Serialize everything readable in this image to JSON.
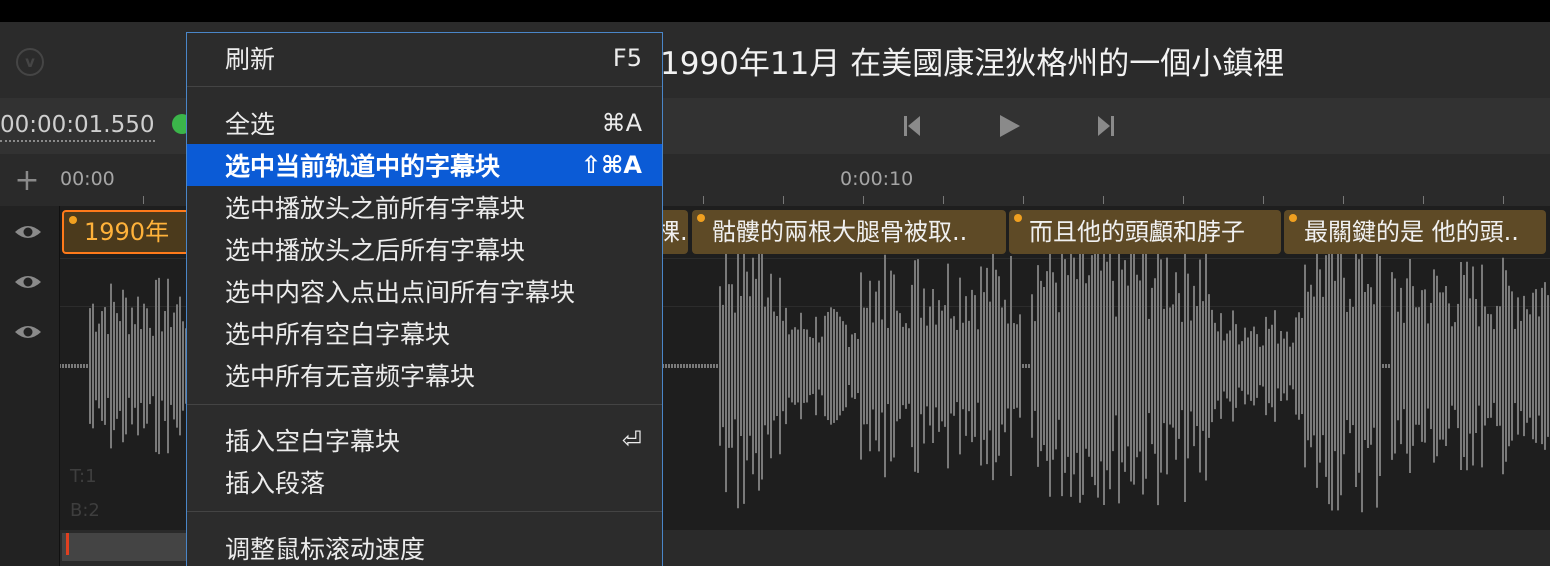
{
  "header": {
    "subtitle": "1990年11月 在美國康涅狄格州的一個小鎮裡"
  },
  "logo_icon": "v-circle-logo",
  "toolbar": {
    "timecode": "00:00:01.550",
    "buttons": [
      "skip-back-icon",
      "play-icon",
      "skip-forward-icon"
    ]
  },
  "ruler": {
    "add_icon": "+",
    "ticks": [
      "00:00",
      "0:00:10"
    ]
  },
  "tracks": {
    "subtitle_blocks": [
      {
        "text": "1990年",
        "selected": true
      },
      {
        "text": "棵..",
        "selected": false
      },
      {
        "text": "骷髏的兩根大腿骨被取..",
        "selected": false
      },
      {
        "text": "而且他的頭顱和脖子",
        "selected": false
      },
      {
        "text": "最關鍵的是 他的頭..",
        "selected": false
      }
    ],
    "label_t": "T:1",
    "label_b": "B:2"
  },
  "context_menu": {
    "items": [
      {
        "label": "刷新",
        "shortcut": "F5"
      },
      {
        "label": "全选",
        "shortcut": "⌘A"
      },
      {
        "label": "选中当前轨道中的字幕块",
        "shortcut": "⇧⌘A",
        "highlighted": true
      },
      {
        "label": "选中播放头之前所有字幕块",
        "shortcut": ""
      },
      {
        "label": "选中播放头之后所有字幕块",
        "shortcut": ""
      },
      {
        "label": "选中内容入点出点间所有字幕块",
        "shortcut": ""
      },
      {
        "label": "选中所有空白字幕块",
        "shortcut": ""
      },
      {
        "label": "选中所有无音频字幕块",
        "shortcut": ""
      },
      {
        "label": "插入空白字幕块",
        "shortcut": "⏎"
      },
      {
        "label": "插入段落",
        "shortcut": ""
      },
      {
        "label": "调整鼠标滚动速度",
        "shortcut": ""
      }
    ]
  },
  "colors": {
    "menu_highlight": "#0b5bd6",
    "block_fill": "#5e4a26",
    "block_selected_border": "#ff7a1a",
    "playhead_green": "#3bb54a"
  }
}
